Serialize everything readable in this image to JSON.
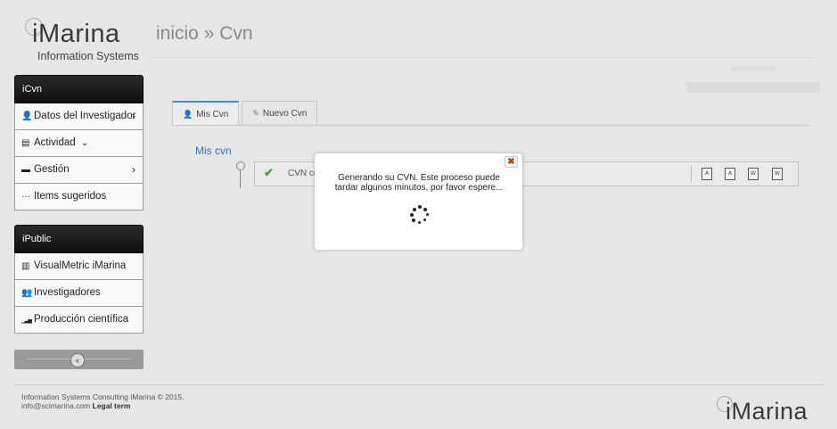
{
  "brand": {
    "name": "iMarina",
    "subtitle": "Information Systems"
  },
  "breadcrumb": "inicio » Cvn",
  "sidebar": {
    "sections": [
      {
        "title": "iCvn",
        "items": [
          {
            "icon": "user-icon",
            "glyph": "👤",
            "label": "Datos del Investigador",
            "arrow": "›"
          },
          {
            "icon": "document-icon",
            "glyph": "▤",
            "label": "Actividad",
            "arrow": "⌄"
          },
          {
            "icon": "briefcase-icon",
            "glyph": "▬",
            "label": "Gestión",
            "arrow": "›"
          },
          {
            "icon": "ellipsis-icon",
            "glyph": "···",
            "label": "Items sugeridos",
            "arrow": ""
          }
        ]
      },
      {
        "title": "iPublic",
        "items": [
          {
            "icon": "chart-icon",
            "glyph": "▥",
            "label": "VisualMetric iMarina",
            "arrow": ""
          },
          {
            "icon": "users-icon",
            "glyph": "👥",
            "label": "Investigadores",
            "arrow": ""
          },
          {
            "icon": "signal-bars-icon",
            "glyph": "▁▃▅",
            "label": "Producción científica",
            "arrow": ""
          }
        ]
      }
    ],
    "collapse_glyph": "«"
  },
  "tabs": [
    {
      "icon": "user-icon",
      "glyph": "👤",
      "label": "Mis Cvn",
      "active": true
    },
    {
      "icon": "edit-icon",
      "glyph": "✎",
      "label": "Nuevo Cvn",
      "active": false
    }
  ],
  "mis_cvn": {
    "heading": "Mis cvn",
    "row_label": "CVN cc",
    "export_icons": [
      "pdf-icon",
      "pdf-icon",
      "word-icon",
      "word-icon"
    ]
  },
  "modal": {
    "message": "Generando su CVN. Este proceso puede tardar algunos minutos, por favor espere...",
    "close_glyph": "✖"
  },
  "footer": {
    "line1": "Information Systems Consulting iMarina © 2015.",
    "line2_email": "info@scimarina.com",
    "line2_link": "Legal term"
  },
  "colors": {
    "accent": "#3a8fc7",
    "link": "#3a6fb0",
    "sidebar_header": "#1a1a1a",
    "close": "#c0392b"
  }
}
